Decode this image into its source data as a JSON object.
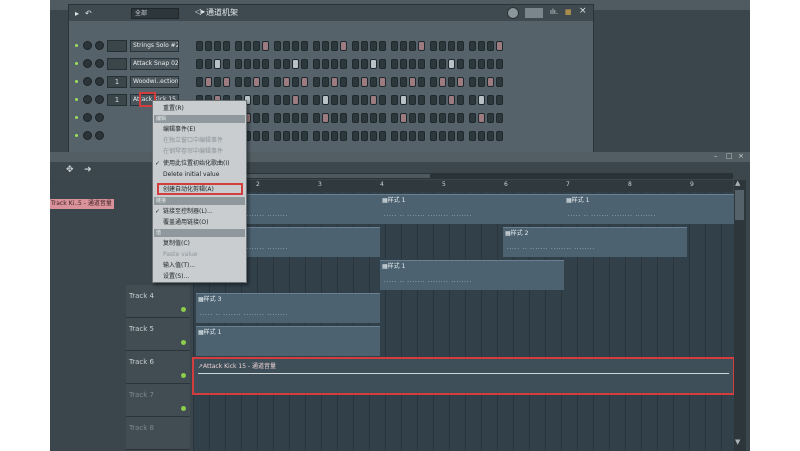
{
  "rack": {
    "transport_icon": "▸",
    "undo_icon": "↶",
    "filter_combo": "全部",
    "title_icon": "◁▸",
    "title": "通道机架",
    "bars_icon": "ılı.",
    "grid_icon": "▦",
    "close_icon": "×",
    "channels": [
      {
        "num": "",
        "name": "Strings Solo #2"
      },
      {
        "num": "",
        "name": "Attack Snap 02"
      },
      {
        "num": "1",
        "name": "Woodwi..ection"
      },
      {
        "num": "1",
        "name": "Attack Kick 15"
      },
      {
        "num": "",
        "name": ""
      },
      {
        "num": "",
        "name": ""
      }
    ]
  },
  "context_menu": {
    "items": {
      "reset": "重置(R)",
      "section_edit": "编辑",
      "edit_events": "编辑事件(E)",
      "edit_events_window": "在独立窗口中编辑事件",
      "edit_events_piano": "在钢琴卷帘中编辑事件",
      "use_position_init": "使用此位置初始化歌曲(I)",
      "delete_initial": "Delete initial value",
      "create_auto_clip": "创建自动化剪辑(A)",
      "section_link": "链接",
      "link_controller": "链接至控制器(L)...",
      "overwrite_link": "覆盖通用链接(O)",
      "section_value": "值",
      "copy_value": "复制值(C)",
      "paste_value": "Paste value",
      "input_value": "输入值(T)...",
      "settings": "设置(S)..."
    }
  },
  "playlist": {
    "ruler": [
      "1",
      "2",
      "3",
      "4",
      "5",
      "6",
      "7",
      "8",
      "9"
    ],
    "track_tag": "Track Ki..5 - 通道音量",
    "tracks": [
      {
        "name": "Track 4"
      },
      {
        "name": "Track 5"
      },
      {
        "name": "Track 6"
      },
      {
        "name": "Track 7"
      },
      {
        "name": "Track 8"
      }
    ],
    "clips": {
      "p1_label": "▦样式 1",
      "p2_label": "▦样式 2",
      "p3_label": "▦样式 3",
      "notes": "..... .. ....... ........ ........"
    },
    "auto_clip_label": "↗Attack Kick 15 - 通道音量"
  },
  "colors": {
    "highlight": "#d43d3d",
    "accent_green": "#8fd14f",
    "tag_pink": "#d9929a"
  }
}
